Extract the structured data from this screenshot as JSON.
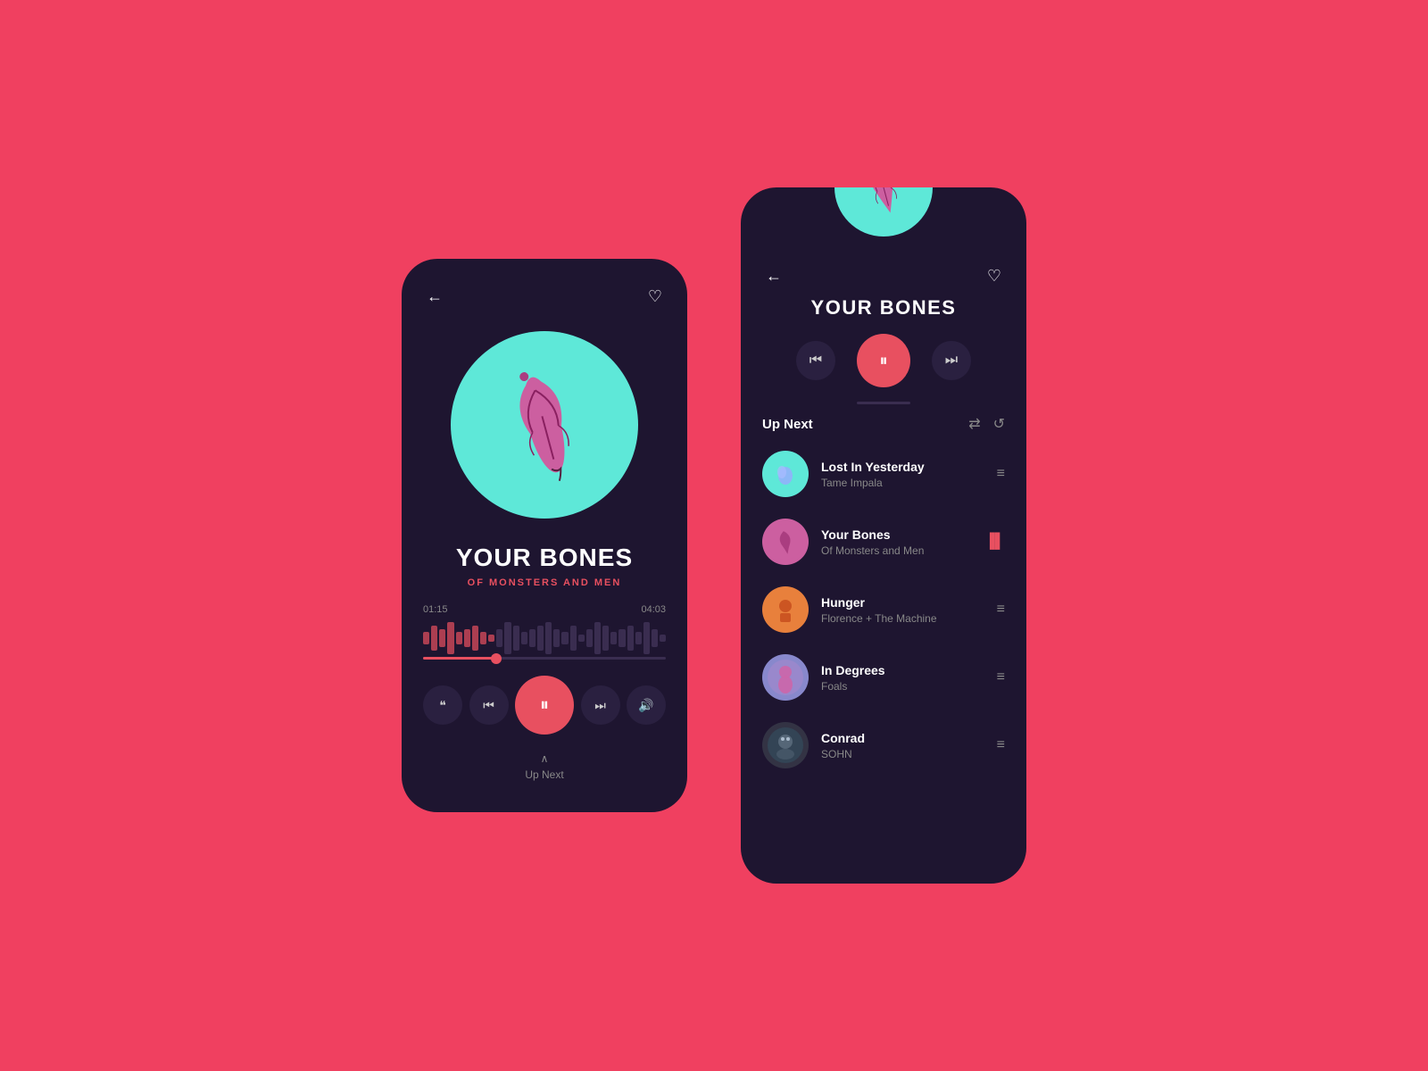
{
  "app": {
    "background": "#f04060"
  },
  "left_phone": {
    "back_label": "←",
    "heart_label": "♡",
    "song_title": "YOUR BONES",
    "song_artist": "OF MONSTERS AND MEN",
    "time_current": "01:15",
    "time_total": "04:03",
    "progress_pct": 30,
    "controls": {
      "lyrics_label": "❝",
      "prev_label": "⏮",
      "play_pause_label": "⏸",
      "next_label": "⏭",
      "volume_label": "🔊"
    },
    "up_next_label": "Up Next"
  },
  "right_phone": {
    "back_label": "←",
    "heart_label": "♡",
    "song_title": "YOUR BONES",
    "controls": {
      "prev_label": "⏮",
      "play_pause_label": "⏸",
      "next_label": "⏭"
    },
    "up_next_label": "Up Next",
    "shuffle_label": "⇄",
    "repeat_label": "↺",
    "playlist": [
      {
        "id": 1,
        "title": "Lost In Yesterday",
        "artist": "Tame Impala",
        "thumb_color": "teal",
        "is_playing": false,
        "action": "≡"
      },
      {
        "id": 2,
        "title": "Your Bones",
        "artist": "Of Monsters and Men",
        "thumb_color": "pink",
        "is_playing": true,
        "action": "▐▐"
      },
      {
        "id": 3,
        "title": "Hunger",
        "artist": "Florence + The Machine",
        "thumb_color": "orange",
        "is_playing": false,
        "action": "≡"
      },
      {
        "id": 4,
        "title": "In Degrees",
        "artist": "Foals",
        "thumb_color": "lavender",
        "is_playing": false,
        "action": "≡"
      },
      {
        "id": 5,
        "title": "Conrad",
        "artist": "SOHN",
        "thumb_color": "dark",
        "is_playing": false,
        "action": "≡"
      }
    ]
  }
}
